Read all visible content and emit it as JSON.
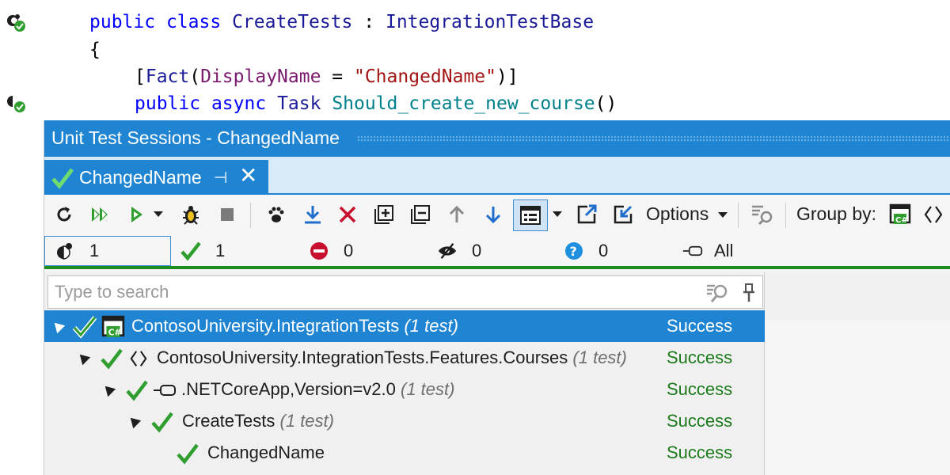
{
  "editor": {
    "line1": {
      "kw1": "public",
      "kw2": "class",
      "cls": "CreateTests",
      "sep": ":",
      "base": "IntegrationTestBase"
    },
    "line2": {
      "brace": "{"
    },
    "line3": {
      "open": "[",
      "attr": "Fact",
      "paren": "(",
      "prop": "DisplayName",
      "eq": " = ",
      "str": "\"ChangedName\"",
      "close": ")]"
    },
    "line4": {
      "kw1": "public",
      "kw2": "async",
      "type": "Task",
      "method": "Should_create_new_course",
      "parens": "()"
    }
  },
  "window": {
    "title": "Unit Test Sessions - ChangedName",
    "tab": {
      "label": "ChangedName",
      "pin_glyph": "⊣",
      "close_glyph": "✕"
    }
  },
  "toolbar": {
    "options_label": "Options",
    "group_by_label": "Group by:"
  },
  "filters": [
    {
      "icon": "all-tests-icon",
      "count": "1"
    },
    {
      "icon": "passed-icon",
      "count": "1"
    },
    {
      "icon": "failed-icon",
      "count": "0"
    },
    {
      "icon": "ignored-icon",
      "count": "0"
    },
    {
      "icon": "unknown-icon",
      "count": "0"
    },
    {
      "icon": "target-framework-icon",
      "count": "All"
    }
  ],
  "search": {
    "placeholder": "Type to search",
    "value": ""
  },
  "tree": [
    {
      "name": "ContosoUniversity.IntegrationTests",
      "count": "(1 test)",
      "status": "Success"
    },
    {
      "name": "ContosoUniversity.IntegrationTests.Features.Courses",
      "count": "(1 test)",
      "status": "Success"
    },
    {
      "name": ".NETCoreApp,Version=v2.0",
      "count": "(1 test)",
      "status": "Success"
    },
    {
      "name": "CreateTests",
      "count": "(1 test)",
      "status": "Success"
    },
    {
      "name": "ChangedName",
      "count": "",
      "status": "Success"
    }
  ],
  "colors": {
    "accent": "#1f84d2",
    "success": "#1c7a1c",
    "check": "#2f9e2f",
    "failed": "#c8102e"
  }
}
